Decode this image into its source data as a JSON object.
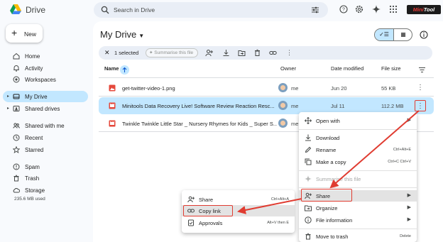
{
  "app": {
    "name": "Drive",
    "brand_overlay": {
      "text_a": "Mini",
      "text_b": "Tool"
    }
  },
  "search": {
    "placeholder": "Search in Drive"
  },
  "new_button": {
    "label": "New"
  },
  "sidebar": {
    "items": [
      {
        "label": "Home",
        "icon": "home-icon"
      },
      {
        "label": "Activity",
        "icon": "bell-icon"
      },
      {
        "label": "Workspaces",
        "icon": "workspaces-icon"
      },
      {
        "label": "My Drive",
        "icon": "drive-icon",
        "active": true
      },
      {
        "label": "Shared drives",
        "icon": "shared-drives-icon"
      },
      {
        "label": "Shared with me",
        "icon": "people-icon"
      },
      {
        "label": "Recent",
        "icon": "clock-icon"
      },
      {
        "label": "Starred",
        "icon": "star-icon"
      },
      {
        "label": "Spam",
        "icon": "spam-icon"
      },
      {
        "label": "Trash",
        "icon": "trash-icon"
      },
      {
        "label": "Storage",
        "icon": "cloud-icon"
      }
    ],
    "storage_used": "235.6 MB used"
  },
  "main": {
    "title": "My Drive",
    "selection": {
      "count_text": "1 selected",
      "summarise": "Summarise this file"
    },
    "columns": {
      "name": "Name",
      "owner": "Owner",
      "modified": "Date modified",
      "size": "File size"
    },
    "files": [
      {
        "name": "get-twitter-video-1.png",
        "owner": "me",
        "date": "Jun 20",
        "size": "55 KB",
        "type": "image"
      },
      {
        "name": "Minitools Data Recovery Live! Software Review Reaction Resc...",
        "owner": "me",
        "date": "Jul 11",
        "size": "112.2 MB",
        "type": "video",
        "selected": true
      },
      {
        "name": "Twinkle Twinkle Little Star _ Nursery Rhymes for Kids _ Super S...",
        "owner": "me",
        "date": "",
        "size": "",
        "type": "video"
      }
    ]
  },
  "context_menu": {
    "items": [
      {
        "label": "Open with",
        "shortcut": "",
        "submenu": true
      },
      {
        "label": "Download",
        "shortcut": ""
      },
      {
        "label": "Rename",
        "shortcut": "Ctrl+Alt+E"
      },
      {
        "label": "Make a copy",
        "shortcut": "Ctrl+C Ctrl+V"
      },
      {
        "label": "Summarise this file",
        "shortcut": "",
        "disabled": true
      },
      {
        "label": "Share",
        "shortcut": "",
        "submenu": true
      },
      {
        "label": "Organize",
        "shortcut": "",
        "submenu": true
      },
      {
        "label": "File information",
        "shortcut": "",
        "submenu": true
      },
      {
        "label": "Move to trash",
        "shortcut": "Delete"
      }
    ]
  },
  "share_submenu": {
    "items": [
      {
        "label": "Share",
        "shortcut": "Ctrl+Alt+A"
      },
      {
        "label": "Copy link",
        "shortcut": ""
      },
      {
        "label": "Approvals",
        "shortcut": "Alt+V then E"
      }
    ]
  },
  "colors": {
    "accent": "#c2e7ff",
    "annotation_red": "#e03c31",
    "background": "#f8fafd"
  }
}
